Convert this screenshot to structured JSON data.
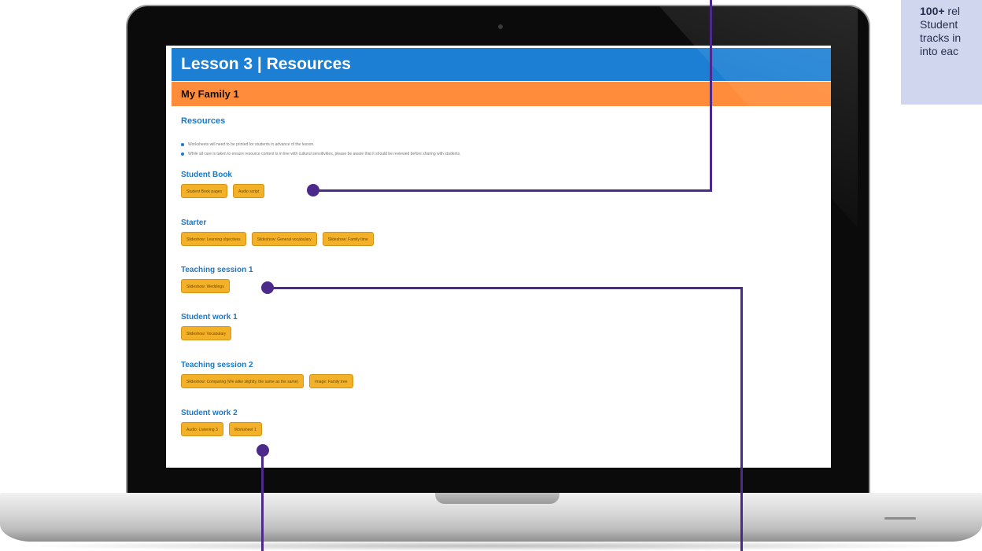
{
  "page": {
    "title": "Lesson 3 | Resources",
    "subtitle": "My Family 1",
    "resources_heading": "Resources"
  },
  "notes": [
    "Worksheets will need to be printed for students in advance of the lesson.",
    "While all care is taken to ensure resource content is in line with cultural sensitivities, please be aware that it should be reviewed before sharing with students."
  ],
  "sections": [
    {
      "title": "Student Book",
      "buttons": [
        "Student Book pages",
        "Audio script"
      ]
    },
    {
      "title": "Starter",
      "buttons": [
        "Slideshow: Learning objectives",
        "Slideshow: General vocabulary",
        "Slideshow: Family time"
      ]
    },
    {
      "title": "Teaching session 1",
      "buttons": [
        "Slideshow: Weddings"
      ]
    },
    {
      "title": "Student work 1",
      "buttons": [
        "Slideshow: Vocabulary"
      ]
    },
    {
      "title": "Teaching session 2",
      "buttons": [
        "Slideshow: Comparing (We alike slightly, the same as the same)",
        "Image: Family tree"
      ]
    },
    {
      "title": "Student work 2",
      "buttons": [
        "Audio: Listening 3",
        "Worksheet 1"
      ]
    }
  ],
  "callout": {
    "strong": "100+",
    "text_1": " rel",
    "line_2": "Student",
    "line_3": "tracks in",
    "line_4": "into eac"
  },
  "colors": {
    "title_bar": "#1c7fd3",
    "subtitle_bar": "#ff8c3a",
    "button": "#f3b12a",
    "callout_line": "#4b2a8c",
    "info_box": "#cfd6ee"
  }
}
